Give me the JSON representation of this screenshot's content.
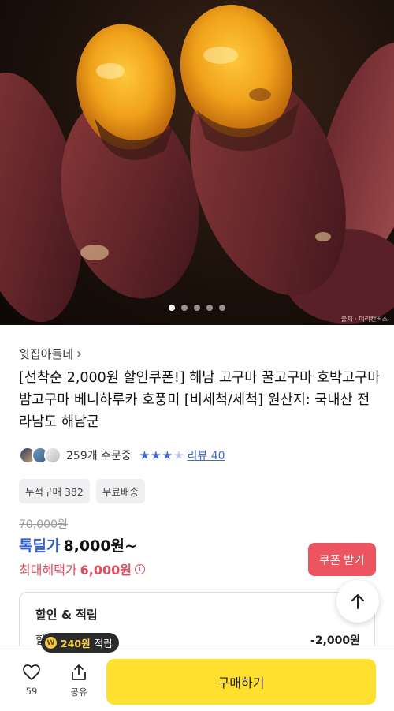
{
  "hero": {
    "credit": "출처 · 미리캔버스",
    "slides_total": 5,
    "active_slide": 1
  },
  "store": {
    "name": "윗집아들네",
    "chevron": "›"
  },
  "product": {
    "title": "[선착순 2,000원 할인쿠폰!] 해남 고구마 꿀고구마 호박고구마 밤고구마 베니하루카 호풍미 [비세척/세척] 원산지: 국내산 전라남도 해남군"
  },
  "meta": {
    "order_count": "259개 주문중",
    "rating": 3.5,
    "review_link": "리뷰 40"
  },
  "badges": [
    "누적구매 382",
    "무료배송"
  ],
  "price": {
    "original": "70,000원",
    "label": "톡딜가",
    "value": "8,000원~",
    "benefit_label": "최대혜택가",
    "benefit_value": "6,000원",
    "info_icon": "i"
  },
  "coupon_button": "쿠폰 받기",
  "discount": {
    "title": "할인 & 적립",
    "row_label": "할인",
    "row_value": "-2,000원"
  },
  "reward_tooltip": {
    "coin": "W",
    "amount": "240원",
    "suffix": "적립"
  },
  "bottom_bar": {
    "like_count": "59",
    "share_label": "공유",
    "buy_label": "구매하기"
  },
  "icons": {
    "scroll_top": "arrow-up-icon",
    "like": "heart-icon",
    "share": "share-icon"
  },
  "colors": {
    "accent_blue": "#2f5fd0",
    "benefit_red": "#e44a5a",
    "coupon_bg": "#ec5560",
    "buy_yellow": "#ffe02e"
  }
}
